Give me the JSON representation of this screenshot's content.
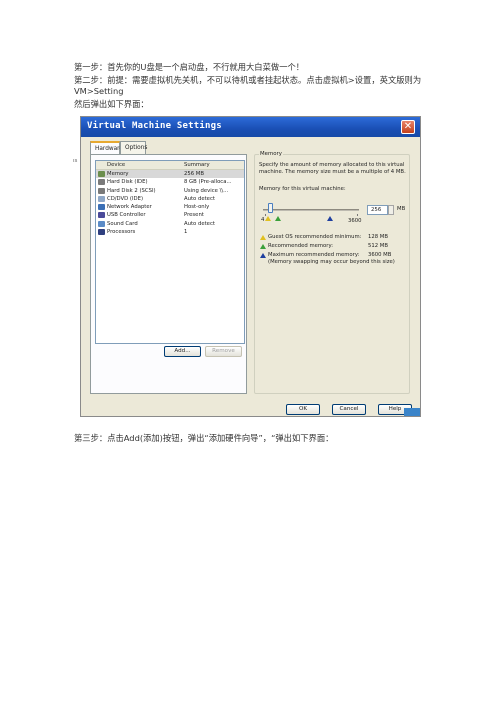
{
  "doc": {
    "step1": "第一步：首先你的U盘是一个启动盘，不行就用大白菜做一个！",
    "step2": "第二步：前提：需要虚拟机先关机，不可以待机或者挂起状态。点击虚拟机>设置，英文版则为VM>Setting",
    "step2_cont": "然后弹出如下界面：",
    "step3": "第三步：点击Add(添加)按钮，弹出“添加硬件向导”，“弹出如下界面："
  },
  "dialog": {
    "title": "Virtual Machine Settings",
    "close_glyph": "✕",
    "tabs": [
      "Hardware",
      "Options"
    ],
    "table_headers": {
      "device": "Device",
      "summary": "Summary"
    },
    "devices": [
      {
        "name": "Memory",
        "summary": "256 MB",
        "icon": "memory-icon",
        "color": "#6b8e4e"
      },
      {
        "name": "Hard Disk (IDE)",
        "summary": "8 GB (Pre-alloca...",
        "icon": "hard-disk-icon",
        "color": "#7a7a7a"
      },
      {
        "name": "Hard Disk 2 (SCSI)",
        "summary": "Using device \\\\...",
        "icon": "hard-disk-icon",
        "color": "#7a7a7a"
      },
      {
        "name": "CD/DVD (IDE)",
        "summary": "Auto detect",
        "icon": "cd-dvd-icon",
        "color": "#8fa8c8"
      },
      {
        "name": "Network Adapter",
        "summary": "Host-only",
        "icon": "network-adapter-icon",
        "color": "#3b6fb6"
      },
      {
        "name": "USB Controller",
        "summary": "Present",
        "icon": "usb-controller-icon",
        "color": "#4a4a9a"
      },
      {
        "name": "Sound Card",
        "summary": "Auto detect",
        "icon": "sound-card-icon",
        "color": "#5b8bc7"
      },
      {
        "name": "Processors",
        "summary": "1",
        "icon": "processor-icon",
        "color": "#2f3f7f"
      }
    ],
    "add_label": "Add...",
    "remove_label": "Remove",
    "memory": {
      "group_label": "Memory",
      "desc1": "Specify the amount of memory allocated to this virtual",
      "desc2": "machine. The memory size must be a multiple of 4 MB.",
      "for_vm_label": "Memory for this virtual machine:",
      "value": "256",
      "unit": "MB",
      "slider_min": "4",
      "slider_max": "3600",
      "slider_level_fraction": 0.07,
      "guest_label": "Guest OS recommended minimum:",
      "guest_value": "128 MB",
      "recommended_label": "Recommended memory:",
      "recommended_value": "512 MB",
      "max_label": "Maximum recommended memory:",
      "max_value": "3600 MB",
      "max_note": "(Memory swapping may occur beyond this size)",
      "marker_colors": {
        "guest": "#e0c020",
        "recommended": "#3aa03a",
        "max": "#1f3f9f"
      }
    },
    "ok_label": "OK",
    "cancel_label": "Cancel",
    "help_label": "Help"
  }
}
